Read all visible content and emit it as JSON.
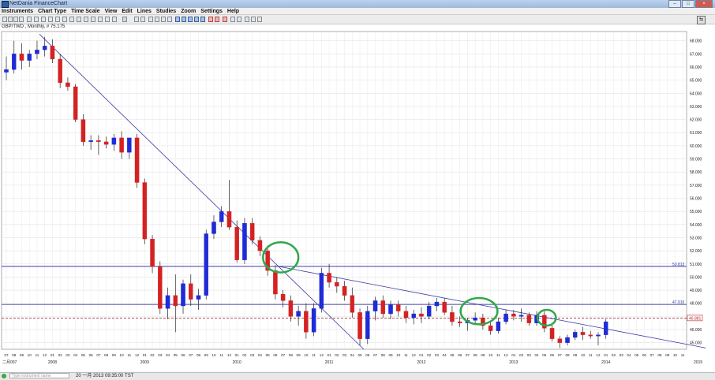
{
  "window": {
    "title": "NetDania FinanceChart"
  },
  "menu": [
    "Instruments",
    "Chart Type",
    "Time Scale",
    "View",
    "Edit",
    "Lines",
    "Studies",
    "Zoom",
    "Settings",
    "Help"
  ],
  "instrument_label": "GBP/TWD , Monthly, # 75.175",
  "status": {
    "command_placeholder": "Type instrument name",
    "timestamp": "20 一月 2013 09:35:00 TST"
  },
  "colors": {
    "up": "#1f2bd6",
    "down": "#d42222",
    "trendline": "#3a3aa8",
    "annotation": "#2ea84a",
    "highlight": "#f5e400"
  },
  "chart_data": {
    "type": "candlestick",
    "y_ticks": [
      "68.000",
      "67.000",
      "66.000",
      "65.000",
      "64.000",
      "63.000",
      "62.000",
      "61.000",
      "60.000",
      "59.000",
      "58.000",
      "57.000",
      "56.000",
      "55.000",
      "54.000",
      "53.000",
      "52.000",
      "51.000",
      "50.000",
      "49.000",
      "48.000",
      "47.000",
      "46.000",
      "45.000"
    ],
    "ylim": [
      44.5,
      68.7
    ],
    "level_labels": [
      {
        "text": "50.813",
        "value": 50.813
      },
      {
        "text": "47.910",
        "value": 47.91
      },
      {
        "text": "46.881",
        "value": 46.881
      }
    ],
    "x_month_ticks": [
      "07",
      "08",
      "09",
      "10",
      "11",
      "12",
      "01",
      "02",
      "03",
      "04",
      "05",
      "06",
      "07",
      "08",
      "09",
      "10",
      "11",
      "12",
      "01",
      "02",
      "03",
      "04",
      "05",
      "06",
      "07",
      "08",
      "09",
      "10",
      "11",
      "12",
      "01",
      "02",
      "03",
      "04",
      "05",
      "06",
      "07",
      "08",
      "09",
      "10",
      "11",
      "12",
      "01",
      "02",
      "03",
      "04",
      "05",
      "06",
      "07",
      "08",
      "09",
      "10",
      "11",
      "12",
      "01",
      "02",
      "03",
      "04",
      "05",
      "06",
      "07",
      "08",
      "09",
      "10",
      "11",
      "12",
      "01",
      "02",
      "03",
      "04",
      "05",
      "06",
      "07",
      "08",
      "09",
      "10",
      "11",
      "12",
      "01",
      "02",
      "03",
      "04",
      "05",
      "06",
      "07",
      "08",
      "09",
      "10",
      "11",
      "12",
      "01",
      "02",
      "03",
      "04",
      "05",
      "06",
      "07",
      "08",
      "09",
      "10",
      "11",
      "12",
      "01",
      "02",
      "03",
      "04",
      "05",
      "06",
      "07",
      "08",
      "09",
      "10",
      "11",
      "12",
      "01",
      "02"
    ],
    "x_year_labels": [
      {
        "text": "二月007",
        "index": 0
      },
      {
        "text": "2008",
        "index": 6
      },
      {
        "text": "2009",
        "index": 18
      },
      {
        "text": "2010",
        "index": 30
      },
      {
        "text": "2011",
        "index": 42
      },
      {
        "text": "2012",
        "index": 54
      },
      {
        "text": "2013",
        "index": 66
      },
      {
        "text": "2014",
        "index": 78
      },
      {
        "text": "2015",
        "index": 90
      },
      {
        "text": "2016",
        "index": 102
      }
    ],
    "candles": [
      {
        "o": 65.6,
        "h": 66.8,
        "l": 65.0,
        "c": 65.8
      },
      {
        "o": 65.8,
        "h": 68.0,
        "l": 65.5,
        "c": 67.0
      },
      {
        "o": 67.0,
        "h": 67.8,
        "l": 65.8,
        "c": 66.5
      },
      {
        "o": 66.5,
        "h": 67.3,
        "l": 66.0,
        "c": 67.0
      },
      {
        "o": 67.0,
        "h": 68.0,
        "l": 66.6,
        "c": 67.3
      },
      {
        "o": 67.3,
        "h": 68.3,
        "l": 66.8,
        "c": 67.6
      },
      {
        "o": 67.6,
        "h": 68.1,
        "l": 66.3,
        "c": 66.6
      },
      {
        "o": 66.6,
        "h": 67.0,
        "l": 64.4,
        "c": 64.8
      },
      {
        "o": 64.8,
        "h": 65.2,
        "l": 64.2,
        "c": 64.5
      },
      {
        "o": 64.5,
        "h": 64.7,
        "l": 61.8,
        "c": 62.0
      },
      {
        "o": 62.0,
        "h": 62.4,
        "l": 60.0,
        "c": 60.3
      },
      {
        "o": 60.3,
        "h": 60.8,
        "l": 59.7,
        "c": 60.4
      },
      {
        "o": 60.4,
        "h": 60.8,
        "l": 59.3,
        "c": 60.3
      },
      {
        "o": 60.3,
        "h": 60.7,
        "l": 59.8,
        "c": 60.1
      },
      {
        "o": 60.1,
        "h": 60.9,
        "l": 59.6,
        "c": 60.6
      },
      {
        "o": 60.6,
        "h": 61.1,
        "l": 59.0,
        "c": 59.5
      },
      {
        "o": 59.5,
        "h": 60.2,
        "l": 59.0,
        "c": 60.6
      },
      {
        "o": 60.6,
        "h": 60.9,
        "l": 56.8,
        "c": 57.2
      },
      {
        "o": 57.2,
        "h": 57.5,
        "l": 52.5,
        "c": 52.9
      },
      {
        "o": 52.9,
        "h": 53.2,
        "l": 50.3,
        "c": 50.8
      },
      {
        "o": 50.8,
        "h": 51.2,
        "l": 47.2,
        "c": 47.6
      },
      {
        "o": 47.6,
        "h": 49.2,
        "l": 46.8,
        "c": 48.6
      },
      {
        "o": 48.6,
        "h": 50.2,
        "l": 45.8,
        "c": 47.8
      },
      {
        "o": 47.8,
        "h": 49.8,
        "l": 47.2,
        "c": 49.5
      },
      {
        "o": 49.5,
        "h": 50.2,
        "l": 47.8,
        "c": 48.3
      },
      {
        "o": 48.3,
        "h": 49.1,
        "l": 47.5,
        "c": 48.6
      },
      {
        "o": 48.6,
        "h": 53.6,
        "l": 48.3,
        "c": 53.3
      },
      {
        "o": 53.3,
        "h": 54.7,
        "l": 52.9,
        "c": 54.2
      },
      {
        "o": 54.2,
        "h": 55.4,
        "l": 53.8,
        "c": 55.0
      },
      {
        "o": 55.0,
        "h": 57.4,
        "l": 53.6,
        "c": 53.8
      },
      {
        "o": 53.8,
        "h": 54.3,
        "l": 51.1,
        "c": 51.3
      },
      {
        "o": 51.3,
        "h": 54.5,
        "l": 51.0,
        "c": 54.1
      },
      {
        "o": 54.1,
        "h": 54.5,
        "l": 52.5,
        "c": 52.8
      },
      {
        "o": 52.8,
        "h": 53.1,
        "l": 51.6,
        "c": 52.0
      },
      {
        "o": 52.0,
        "h": 52.4,
        "l": 50.1,
        "c": 50.5
      },
      {
        "o": 50.5,
        "h": 50.9,
        "l": 48.3,
        "c": 48.7
      },
      {
        "o": 48.7,
        "h": 49.0,
        "l": 47.7,
        "c": 48.2
      },
      {
        "o": 48.2,
        "h": 48.6,
        "l": 46.6,
        "c": 47.0
      },
      {
        "o": 47.0,
        "h": 47.8,
        "l": 46.3,
        "c": 47.4
      },
      {
        "o": 47.4,
        "h": 48.0,
        "l": 45.3,
        "c": 45.8
      },
      {
        "o": 45.8,
        "h": 48.0,
        "l": 45.5,
        "c": 47.6
      },
      {
        "o": 47.6,
        "h": 50.7,
        "l": 47.3,
        "c": 50.3
      },
      {
        "o": 50.3,
        "h": 51.0,
        "l": 49.2,
        "c": 49.6
      },
      {
        "o": 49.6,
        "h": 50.0,
        "l": 48.8,
        "c": 49.3
      },
      {
        "o": 49.3,
        "h": 49.7,
        "l": 48.2,
        "c": 48.6
      },
      {
        "o": 48.6,
        "h": 49.2,
        "l": 46.9,
        "c": 47.3
      },
      {
        "o": 47.3,
        "h": 47.6,
        "l": 44.8,
        "c": 45.3
      },
      {
        "o": 45.3,
        "h": 47.8,
        "l": 44.9,
        "c": 47.4
      },
      {
        "o": 47.4,
        "h": 48.5,
        "l": 46.7,
        "c": 48.2
      },
      {
        "o": 48.2,
        "h": 48.6,
        "l": 46.9,
        "c": 47.2
      },
      {
        "o": 47.2,
        "h": 48.2,
        "l": 46.8,
        "c": 47.9
      },
      {
        "o": 47.9,
        "h": 48.2,
        "l": 47.0,
        "c": 47.4
      },
      {
        "o": 47.4,
        "h": 47.8,
        "l": 46.5,
        "c": 46.9
      },
      {
        "o": 46.9,
        "h": 47.5,
        "l": 46.4,
        "c": 47.2
      },
      {
        "o": 47.2,
        "h": 47.7,
        "l": 46.5,
        "c": 47.0
      },
      {
        "o": 47.0,
        "h": 48.1,
        "l": 46.8,
        "c": 47.8
      },
      {
        "o": 47.8,
        "h": 48.4,
        "l": 47.4,
        "c": 48.1
      },
      {
        "o": 48.1,
        "h": 48.4,
        "l": 47.1,
        "c": 47.3
      },
      {
        "o": 47.3,
        "h": 47.8,
        "l": 46.3,
        "c": 46.6
      },
      {
        "o": 46.6,
        "h": 47.0,
        "l": 46.2,
        "c": 46.5
      },
      {
        "o": 46.5,
        "h": 46.9,
        "l": 45.9,
        "c": 46.7
      },
      {
        "o": 46.7,
        "h": 47.3,
        "l": 46.4,
        "c": 46.9
      },
      {
        "o": 46.9,
        "h": 47.2,
        "l": 46.0,
        "c": 46.3
      },
      {
        "o": 46.3,
        "h": 46.6,
        "l": 45.6,
        "c": 45.9
      },
      {
        "o": 45.9,
        "h": 46.9,
        "l": 45.7,
        "c": 46.6
      },
      {
        "o": 46.6,
        "h": 47.5,
        "l": 46.4,
        "c": 47.2
      },
      {
        "o": 47.2,
        "h": 47.5,
        "l": 46.7,
        "c": 47.0
      },
      {
        "o": 47.0,
        "h": 47.6,
        "l": 46.6,
        "c": 47.1
      },
      {
        "o": 47.1,
        "h": 47.3,
        "l": 46.3,
        "c": 46.5
      },
      {
        "o": 46.5,
        "h": 47.4,
        "l": 46.3,
        "c": 47.1
      },
      {
        "o": 47.1,
        "h": 47.4,
        "l": 45.8,
        "c": 46.1
      },
      {
        "o": 46.1,
        "h": 46.4,
        "l": 45.1,
        "c": 45.3
      },
      {
        "o": 45.3,
        "h": 45.5,
        "l": 44.6,
        "c": 45.0
      },
      {
        "o": 45.0,
        "h": 45.6,
        "l": 44.8,
        "c": 45.4
      },
      {
        "o": 45.4,
        "h": 46.0,
        "l": 45.2,
        "c": 45.8
      },
      {
        "o": 45.8,
        "h": 46.2,
        "l": 45.2,
        "c": 45.6
      },
      {
        "o": 45.6,
        "h": 45.9,
        "l": 45.3,
        "c": 45.5
      },
      {
        "o": 45.5,
        "h": 45.8,
        "l": 44.8,
        "c": 45.6
      },
      {
        "o": 45.6,
        "h": 46.8,
        "l": 45.3,
        "c": 46.6
      }
    ],
    "trendlines": [
      {
        "x0": 4.3,
        "y0": 68.5,
        "x1": 46.5,
        "y1": 44.5
      },
      {
        "x0": 35.5,
        "y0": 50.8,
        "x1": 91,
        "y1": 44.6
      }
    ],
    "hlines": [
      50.813,
      47.91
    ],
    "dashed_level": 46.881,
    "ellipses": [
      {
        "cx": 35.7,
        "cy": 51.5,
        "rx": 2.3,
        "ry": 1.15
      },
      {
        "cx": 61.5,
        "cy": 47.4,
        "rx": 2.4,
        "ry": 1.0
      },
      {
        "cx": 70.3,
        "cy": 46.9,
        "rx": 1.2,
        "ry": 0.6
      }
    ]
  }
}
